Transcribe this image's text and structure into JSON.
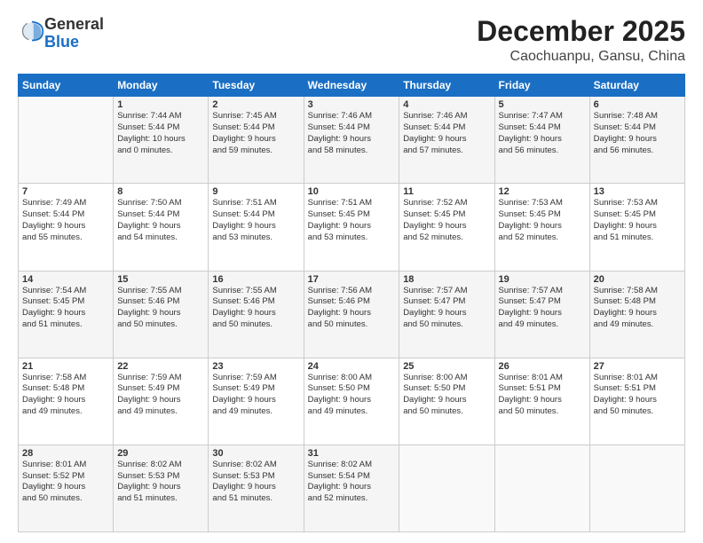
{
  "header": {
    "logo_general": "General",
    "logo_blue": "Blue",
    "month": "December 2025",
    "location": "Caochuanpu, Gansu, China"
  },
  "weekdays": [
    "Sunday",
    "Monday",
    "Tuesday",
    "Wednesday",
    "Thursday",
    "Friday",
    "Saturday"
  ],
  "weeks": [
    [
      {
        "day": "",
        "info": ""
      },
      {
        "day": "1",
        "info": "Sunrise: 7:44 AM\nSunset: 5:44 PM\nDaylight: 10 hours\nand 0 minutes."
      },
      {
        "day": "2",
        "info": "Sunrise: 7:45 AM\nSunset: 5:44 PM\nDaylight: 9 hours\nand 59 minutes."
      },
      {
        "day": "3",
        "info": "Sunrise: 7:46 AM\nSunset: 5:44 PM\nDaylight: 9 hours\nand 58 minutes."
      },
      {
        "day": "4",
        "info": "Sunrise: 7:46 AM\nSunset: 5:44 PM\nDaylight: 9 hours\nand 57 minutes."
      },
      {
        "day": "5",
        "info": "Sunrise: 7:47 AM\nSunset: 5:44 PM\nDaylight: 9 hours\nand 56 minutes."
      },
      {
        "day": "6",
        "info": "Sunrise: 7:48 AM\nSunset: 5:44 PM\nDaylight: 9 hours\nand 56 minutes."
      }
    ],
    [
      {
        "day": "7",
        "info": "Sunrise: 7:49 AM\nSunset: 5:44 PM\nDaylight: 9 hours\nand 55 minutes."
      },
      {
        "day": "8",
        "info": "Sunrise: 7:50 AM\nSunset: 5:44 PM\nDaylight: 9 hours\nand 54 minutes."
      },
      {
        "day": "9",
        "info": "Sunrise: 7:51 AM\nSunset: 5:44 PM\nDaylight: 9 hours\nand 53 minutes."
      },
      {
        "day": "10",
        "info": "Sunrise: 7:51 AM\nSunset: 5:45 PM\nDaylight: 9 hours\nand 53 minutes."
      },
      {
        "day": "11",
        "info": "Sunrise: 7:52 AM\nSunset: 5:45 PM\nDaylight: 9 hours\nand 52 minutes."
      },
      {
        "day": "12",
        "info": "Sunrise: 7:53 AM\nSunset: 5:45 PM\nDaylight: 9 hours\nand 52 minutes."
      },
      {
        "day": "13",
        "info": "Sunrise: 7:53 AM\nSunset: 5:45 PM\nDaylight: 9 hours\nand 51 minutes."
      }
    ],
    [
      {
        "day": "14",
        "info": "Sunrise: 7:54 AM\nSunset: 5:45 PM\nDaylight: 9 hours\nand 51 minutes."
      },
      {
        "day": "15",
        "info": "Sunrise: 7:55 AM\nSunset: 5:46 PM\nDaylight: 9 hours\nand 50 minutes."
      },
      {
        "day": "16",
        "info": "Sunrise: 7:55 AM\nSunset: 5:46 PM\nDaylight: 9 hours\nand 50 minutes."
      },
      {
        "day": "17",
        "info": "Sunrise: 7:56 AM\nSunset: 5:46 PM\nDaylight: 9 hours\nand 50 minutes."
      },
      {
        "day": "18",
        "info": "Sunrise: 7:57 AM\nSunset: 5:47 PM\nDaylight: 9 hours\nand 50 minutes."
      },
      {
        "day": "19",
        "info": "Sunrise: 7:57 AM\nSunset: 5:47 PM\nDaylight: 9 hours\nand 49 minutes."
      },
      {
        "day": "20",
        "info": "Sunrise: 7:58 AM\nSunset: 5:48 PM\nDaylight: 9 hours\nand 49 minutes."
      }
    ],
    [
      {
        "day": "21",
        "info": "Sunrise: 7:58 AM\nSunset: 5:48 PM\nDaylight: 9 hours\nand 49 minutes."
      },
      {
        "day": "22",
        "info": "Sunrise: 7:59 AM\nSunset: 5:49 PM\nDaylight: 9 hours\nand 49 minutes."
      },
      {
        "day": "23",
        "info": "Sunrise: 7:59 AM\nSunset: 5:49 PM\nDaylight: 9 hours\nand 49 minutes."
      },
      {
        "day": "24",
        "info": "Sunrise: 8:00 AM\nSunset: 5:50 PM\nDaylight: 9 hours\nand 49 minutes."
      },
      {
        "day": "25",
        "info": "Sunrise: 8:00 AM\nSunset: 5:50 PM\nDaylight: 9 hours\nand 50 minutes."
      },
      {
        "day": "26",
        "info": "Sunrise: 8:01 AM\nSunset: 5:51 PM\nDaylight: 9 hours\nand 50 minutes."
      },
      {
        "day": "27",
        "info": "Sunrise: 8:01 AM\nSunset: 5:51 PM\nDaylight: 9 hours\nand 50 minutes."
      }
    ],
    [
      {
        "day": "28",
        "info": "Sunrise: 8:01 AM\nSunset: 5:52 PM\nDaylight: 9 hours\nand 50 minutes."
      },
      {
        "day": "29",
        "info": "Sunrise: 8:02 AM\nSunset: 5:53 PM\nDaylight: 9 hours\nand 51 minutes."
      },
      {
        "day": "30",
        "info": "Sunrise: 8:02 AM\nSunset: 5:53 PM\nDaylight: 9 hours\nand 51 minutes."
      },
      {
        "day": "31",
        "info": "Sunrise: 8:02 AM\nSunset: 5:54 PM\nDaylight: 9 hours\nand 52 minutes."
      },
      {
        "day": "",
        "info": ""
      },
      {
        "day": "",
        "info": ""
      },
      {
        "day": "",
        "info": ""
      }
    ]
  ]
}
